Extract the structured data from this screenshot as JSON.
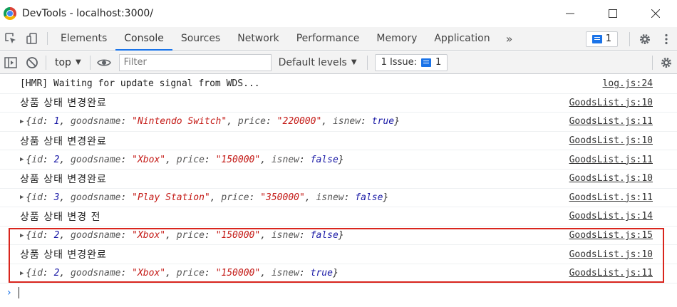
{
  "window": {
    "title": "DevTools - localhost:3000/",
    "minimize_glyph": "─",
    "maximize_glyph": "☐",
    "close_glyph": "✕"
  },
  "tabs": {
    "items": [
      {
        "label": "Elements",
        "active": false
      },
      {
        "label": "Console",
        "active": true
      },
      {
        "label": "Sources",
        "active": false
      },
      {
        "label": "Network",
        "active": false
      },
      {
        "label": "Performance",
        "active": false
      },
      {
        "label": "Memory",
        "active": false
      },
      {
        "label": "Application",
        "active": false
      }
    ],
    "more_glyph": "»",
    "messages_count": "1"
  },
  "console_toolbar": {
    "context": "top",
    "filter_placeholder": "Filter",
    "levels": "Default levels",
    "issue_label": "1 Issue:",
    "issue_count": "1"
  },
  "log": [
    {
      "type": "text",
      "mono": true,
      "text": "[HMR] Waiting for update signal from WDS...",
      "source": "log.js:24"
    },
    {
      "type": "text",
      "mono": false,
      "text": "상품 상태 변경완료",
      "source": "GoodsList.js:10"
    },
    {
      "type": "object",
      "id": "1",
      "goodsname": "\"Nintendo Switch\"",
      "price": "\"220000\"",
      "isnew": "true",
      "source": "GoodsList.js:11"
    },
    {
      "type": "text",
      "mono": false,
      "text": "상품 상태 변경완료",
      "source": "GoodsList.js:10"
    },
    {
      "type": "object",
      "id": "2",
      "goodsname": "\"Xbox\"",
      "price": "\"150000\"",
      "isnew": "false",
      "source": "GoodsList.js:11"
    },
    {
      "type": "text",
      "mono": false,
      "text": "상품 상태 변경완료",
      "source": "GoodsList.js:10"
    },
    {
      "type": "object",
      "id": "3",
      "goodsname": "\"Play Station\"",
      "price": "\"350000\"",
      "isnew": "false",
      "source": "GoodsList.js:11"
    },
    {
      "type": "text",
      "mono": false,
      "text": "상품 상태 변경 전",
      "source": "GoodsList.js:14"
    },
    {
      "type": "object",
      "id": "2",
      "goodsname": "\"Xbox\"",
      "price": "\"150000\"",
      "isnew": "false",
      "source": "GoodsList.js:15"
    },
    {
      "type": "text",
      "mono": false,
      "text": "상품 상태 변경완료",
      "source": "GoodsList.js:10"
    },
    {
      "type": "object",
      "id": "2",
      "goodsname": "\"Xbox\"",
      "price": "\"150000\"",
      "isnew": "true",
      "source": "GoodsList.js:11"
    }
  ],
  "prompt": {
    "glyph": "›"
  },
  "highlight": {
    "color": "#d9251d"
  },
  "colors": {
    "accent": "#1a73e8",
    "string": "#c41a16",
    "boolean": "#1a1aa6",
    "key": "#565656"
  }
}
